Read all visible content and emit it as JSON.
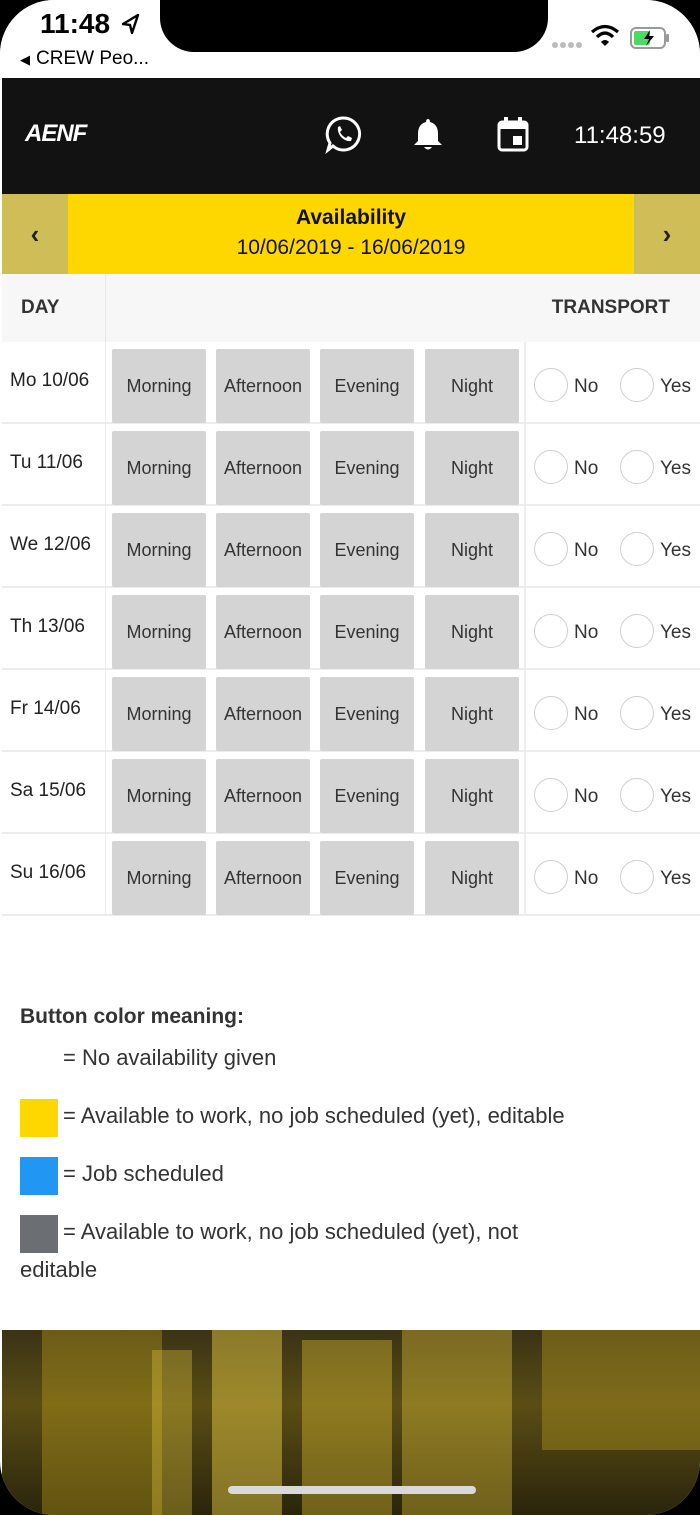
{
  "status_bar": {
    "time": "11:48",
    "back_label": "CREW Peo..."
  },
  "header": {
    "logo": "AENF",
    "clock": "11:48:59",
    "icons": [
      "whatsapp-icon",
      "bell-icon",
      "calendar-icon"
    ]
  },
  "week": {
    "prev": "‹",
    "next": "›",
    "title": "Availability",
    "range": "10/06/2019  - 16/06/2019"
  },
  "table": {
    "col_day": "DAY",
    "col_transport": "TRANSPORT",
    "slot_labels": [
      "Morning",
      "Afternoon",
      "Evening",
      "Night"
    ],
    "transport_no": "No",
    "transport_yes": "Yes",
    "days": [
      "Mo 10/06",
      "Tu 11/06",
      "We 12/06",
      "Th 13/06",
      "Fr 14/06",
      "Sa 15/06",
      "Su 16/06"
    ]
  },
  "legend": {
    "title": "Button color meaning:",
    "items": [
      {
        "color": "#ffffff",
        "text": "= No availability given"
      },
      {
        "color": "#ffd700",
        "text": "= Available to work, no job scheduled (yet), editable"
      },
      {
        "color": "#2196f3",
        "text": "= Job scheduled"
      },
      {
        "color": "#6b6f73",
        "text": "= Available to work, no job scheduled (yet), not"
      }
    ],
    "last_continuation": "editable"
  },
  "colors": {
    "accent_yellow": "#ffd700",
    "header_bg": "#121212",
    "slot_gray": "#d4d4d4"
  }
}
